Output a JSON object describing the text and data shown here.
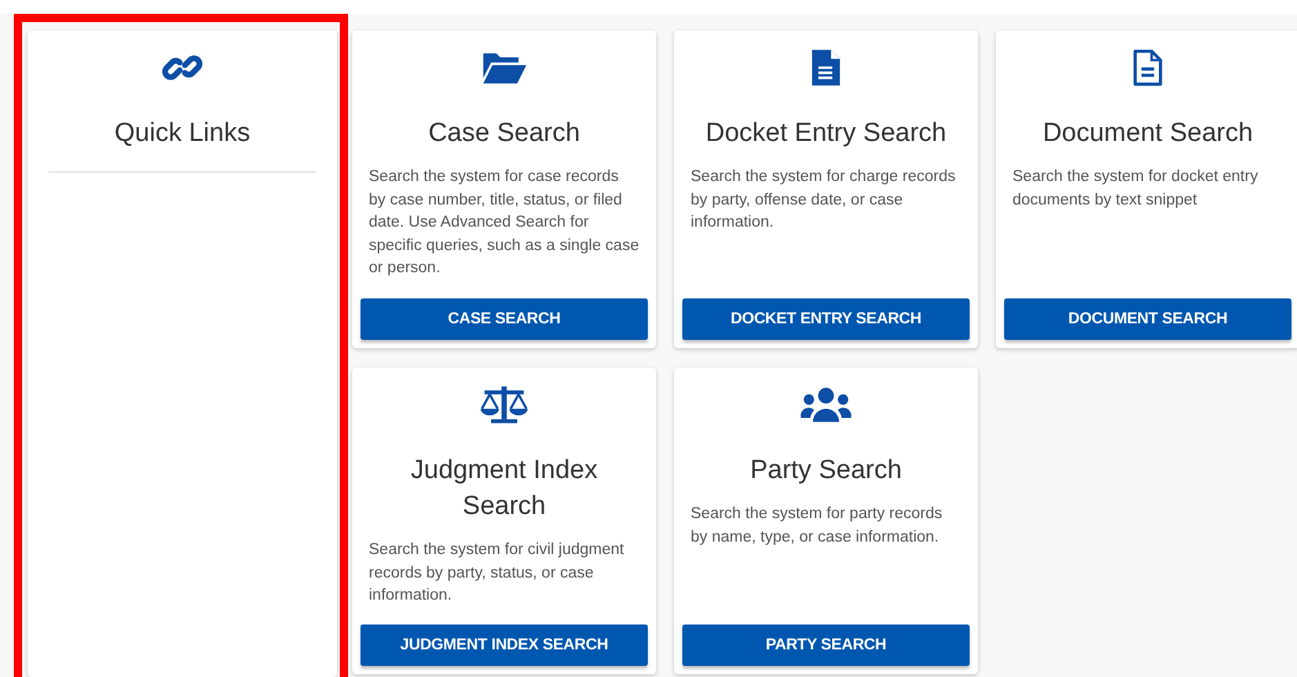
{
  "quick_links": {
    "title": "Quick Links",
    "highlighted": true
  },
  "cards": [
    {
      "title": "Case Search",
      "description": "Search the system for case records by case number, title, status, or filed date. Use Advanced Search for specific queries, such as a single case or person.",
      "button": "CASE SEARCH"
    },
    {
      "title": "Docket Entry Search",
      "description": "Search the system for charge records by party, offense date, or case information.",
      "button": "DOCKET ENTRY SEARCH"
    },
    {
      "title": "Document Search",
      "description": "Search the system for docket entry documents by text snippet",
      "button": "DOCUMENT SEARCH"
    },
    {
      "title": "Judgment Index Search",
      "description": "Search the system for civil judgment records by party, status, or case information.",
      "button": "JUDGMENT INDEX SEARCH"
    },
    {
      "title": "Party Search",
      "description": "Search the system for party records by name, type, or case information.",
      "button": "PARTY SEARCH"
    }
  ]
}
